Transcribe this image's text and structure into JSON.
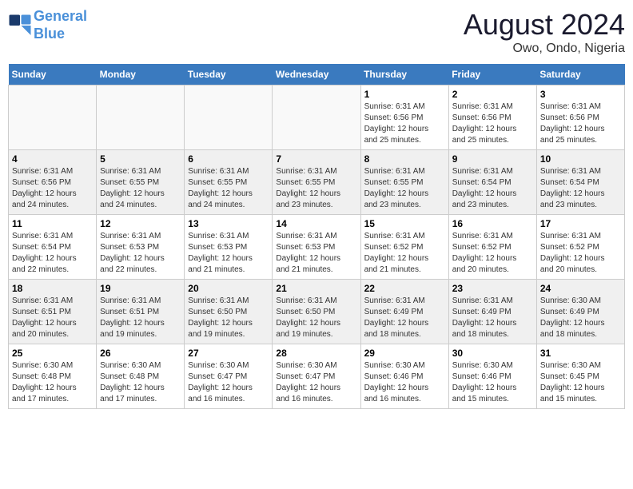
{
  "header": {
    "logo_line1": "General",
    "logo_line2": "Blue",
    "month": "August 2024",
    "location": "Owo, Ondo, Nigeria"
  },
  "weekdays": [
    "Sunday",
    "Monday",
    "Tuesday",
    "Wednesday",
    "Thursday",
    "Friday",
    "Saturday"
  ],
  "weeks": [
    [
      {
        "day": "",
        "info": ""
      },
      {
        "day": "",
        "info": ""
      },
      {
        "day": "",
        "info": ""
      },
      {
        "day": "",
        "info": ""
      },
      {
        "day": "1",
        "info": "Sunrise: 6:31 AM\nSunset: 6:56 PM\nDaylight: 12 hours\nand 25 minutes."
      },
      {
        "day": "2",
        "info": "Sunrise: 6:31 AM\nSunset: 6:56 PM\nDaylight: 12 hours\nand 25 minutes."
      },
      {
        "day": "3",
        "info": "Sunrise: 6:31 AM\nSunset: 6:56 PM\nDaylight: 12 hours\nand 25 minutes."
      }
    ],
    [
      {
        "day": "4",
        "info": "Sunrise: 6:31 AM\nSunset: 6:56 PM\nDaylight: 12 hours\nand 24 minutes."
      },
      {
        "day": "5",
        "info": "Sunrise: 6:31 AM\nSunset: 6:55 PM\nDaylight: 12 hours\nand 24 minutes."
      },
      {
        "day": "6",
        "info": "Sunrise: 6:31 AM\nSunset: 6:55 PM\nDaylight: 12 hours\nand 24 minutes."
      },
      {
        "day": "7",
        "info": "Sunrise: 6:31 AM\nSunset: 6:55 PM\nDaylight: 12 hours\nand 23 minutes."
      },
      {
        "day": "8",
        "info": "Sunrise: 6:31 AM\nSunset: 6:55 PM\nDaylight: 12 hours\nand 23 minutes."
      },
      {
        "day": "9",
        "info": "Sunrise: 6:31 AM\nSunset: 6:54 PM\nDaylight: 12 hours\nand 23 minutes."
      },
      {
        "day": "10",
        "info": "Sunrise: 6:31 AM\nSunset: 6:54 PM\nDaylight: 12 hours\nand 23 minutes."
      }
    ],
    [
      {
        "day": "11",
        "info": "Sunrise: 6:31 AM\nSunset: 6:54 PM\nDaylight: 12 hours\nand 22 minutes."
      },
      {
        "day": "12",
        "info": "Sunrise: 6:31 AM\nSunset: 6:53 PM\nDaylight: 12 hours\nand 22 minutes."
      },
      {
        "day": "13",
        "info": "Sunrise: 6:31 AM\nSunset: 6:53 PM\nDaylight: 12 hours\nand 21 minutes."
      },
      {
        "day": "14",
        "info": "Sunrise: 6:31 AM\nSunset: 6:53 PM\nDaylight: 12 hours\nand 21 minutes."
      },
      {
        "day": "15",
        "info": "Sunrise: 6:31 AM\nSunset: 6:52 PM\nDaylight: 12 hours\nand 21 minutes."
      },
      {
        "day": "16",
        "info": "Sunrise: 6:31 AM\nSunset: 6:52 PM\nDaylight: 12 hours\nand 20 minutes."
      },
      {
        "day": "17",
        "info": "Sunrise: 6:31 AM\nSunset: 6:52 PM\nDaylight: 12 hours\nand 20 minutes."
      }
    ],
    [
      {
        "day": "18",
        "info": "Sunrise: 6:31 AM\nSunset: 6:51 PM\nDaylight: 12 hours\nand 20 minutes."
      },
      {
        "day": "19",
        "info": "Sunrise: 6:31 AM\nSunset: 6:51 PM\nDaylight: 12 hours\nand 19 minutes."
      },
      {
        "day": "20",
        "info": "Sunrise: 6:31 AM\nSunset: 6:50 PM\nDaylight: 12 hours\nand 19 minutes."
      },
      {
        "day": "21",
        "info": "Sunrise: 6:31 AM\nSunset: 6:50 PM\nDaylight: 12 hours\nand 19 minutes."
      },
      {
        "day": "22",
        "info": "Sunrise: 6:31 AM\nSunset: 6:49 PM\nDaylight: 12 hours\nand 18 minutes."
      },
      {
        "day": "23",
        "info": "Sunrise: 6:31 AM\nSunset: 6:49 PM\nDaylight: 12 hours\nand 18 minutes."
      },
      {
        "day": "24",
        "info": "Sunrise: 6:30 AM\nSunset: 6:49 PM\nDaylight: 12 hours\nand 18 minutes."
      }
    ],
    [
      {
        "day": "25",
        "info": "Sunrise: 6:30 AM\nSunset: 6:48 PM\nDaylight: 12 hours\nand 17 minutes."
      },
      {
        "day": "26",
        "info": "Sunrise: 6:30 AM\nSunset: 6:48 PM\nDaylight: 12 hours\nand 17 minutes."
      },
      {
        "day": "27",
        "info": "Sunrise: 6:30 AM\nSunset: 6:47 PM\nDaylight: 12 hours\nand 16 minutes."
      },
      {
        "day": "28",
        "info": "Sunrise: 6:30 AM\nSunset: 6:47 PM\nDaylight: 12 hours\nand 16 minutes."
      },
      {
        "day": "29",
        "info": "Sunrise: 6:30 AM\nSunset: 6:46 PM\nDaylight: 12 hours\nand 16 minutes."
      },
      {
        "day": "30",
        "info": "Sunrise: 6:30 AM\nSunset: 6:46 PM\nDaylight: 12 hours\nand 15 minutes."
      },
      {
        "day": "31",
        "info": "Sunrise: 6:30 AM\nSunset: 6:45 PM\nDaylight: 12 hours\nand 15 minutes."
      }
    ]
  ]
}
